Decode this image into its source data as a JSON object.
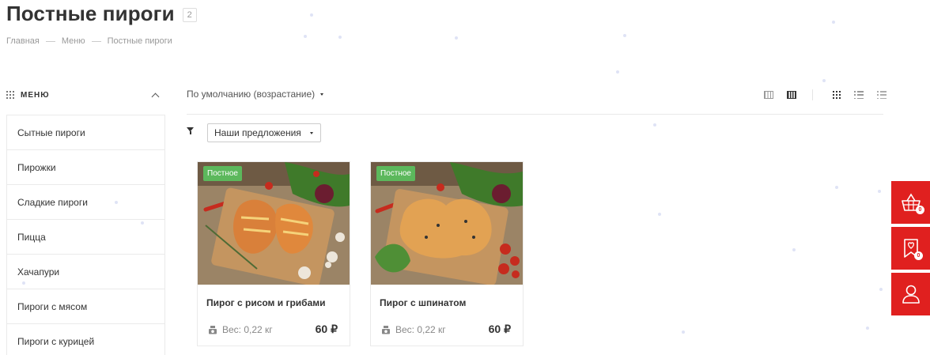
{
  "page": {
    "title": "Постные пироги",
    "count": "2"
  },
  "breadcrumb": [
    "Главная",
    "Меню",
    "Постные пироги"
  ],
  "sidebar": {
    "header": "МЕНЮ",
    "items": [
      "Сытные пироги",
      "Пирожки",
      "Сладкие пироги",
      "Пицца",
      "Хачапури",
      "Пироги с мясом",
      "Пироги с курицей"
    ]
  },
  "toolbar": {
    "sort_label": "По умолчанию (возрастание)",
    "filter_select": "Наши предложения"
  },
  "products": [
    {
      "badge": "Постное",
      "name": "Пирог с рисом и грибами",
      "weight": "Вес: 0,22 кг",
      "price": "60 ₽"
    },
    {
      "badge": "Постное",
      "name": "Пирог с шпинатом",
      "weight": "Вес: 0,22 кг",
      "price": "60 ₽"
    }
  ],
  "side_buttons": {
    "cart_count": "0",
    "favorites_count": "0"
  },
  "colors": {
    "accent": "#e0201f",
    "badge_green": "#5cb85c"
  },
  "icons": [
    "menu-grid-icon",
    "chevron-up-icon",
    "caret-down-icon",
    "view-table-icon",
    "view-block-icon",
    "grid-view-icon",
    "list-view-icon",
    "price-list-icon",
    "filter-icon",
    "scale-icon",
    "basket-icon",
    "heart-bookmark-icon",
    "user-icon"
  ]
}
